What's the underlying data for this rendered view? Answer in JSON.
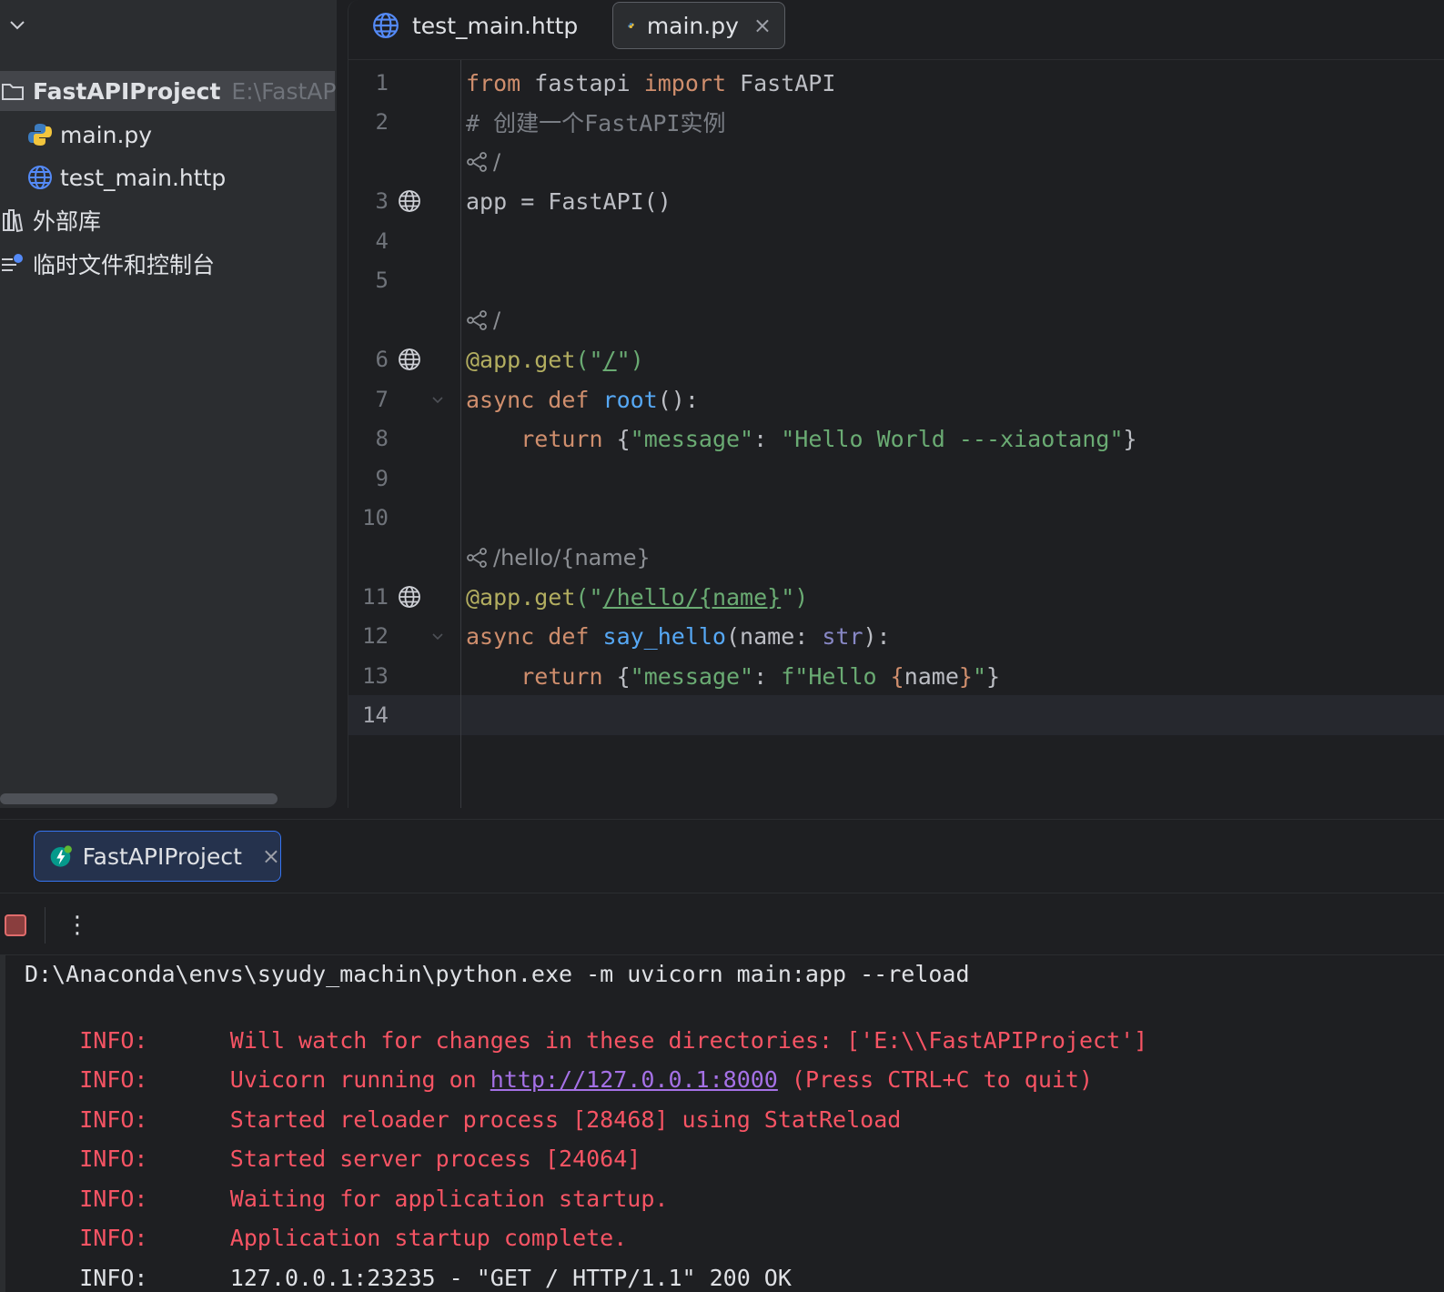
{
  "project": {
    "root_name": "FastAPIProject",
    "root_path": "E:\\FastAPIProj",
    "files": [
      "main.py",
      "test_main.http"
    ],
    "external_libraries": "外部库",
    "scratches": "临时文件和控制台"
  },
  "editor": {
    "tabs": [
      {
        "label": "test_main.http",
        "active": false
      },
      {
        "label": "main.py",
        "active": true
      }
    ],
    "tab_close": "×",
    "line_numbers": [
      "1",
      "2",
      "3",
      "4",
      "5",
      "6",
      "7",
      "8",
      "9",
      "10",
      "11",
      "12",
      "13",
      "14"
    ],
    "inlays": [
      "/",
      "/",
      "/hello/{name}"
    ],
    "code": {
      "l1": [
        "from",
        " fastapi ",
        "import",
        " FastAPI"
      ],
      "l2": "# 创建一个FastAPI实例",
      "l3": "app = FastAPI()",
      "l6": [
        "@app.get",
        "(\"",
        "/",
        "\")"
      ],
      "l7": [
        "async def ",
        "root",
        "():"
      ],
      "l8": [
        "    ",
        "return",
        " {",
        "\"message\"",
        ": ",
        "\"Hello World ---xiaotang\"",
        "}"
      ],
      "l11": [
        "@app.get",
        "(\"",
        "/hello/{name}",
        "\")"
      ],
      "l12": [
        "async def ",
        "say_hello",
        "(name: ",
        "str",
        "):"
      ],
      "l13": [
        "    ",
        "return",
        " {",
        "\"message\"",
        ": ",
        "f\"Hello ",
        "{",
        "name",
        "}",
        "\"",
        "}"
      ]
    }
  },
  "run": {
    "tab_label": "FastAPIProject",
    "tab_close": "×",
    "more": "⋮",
    "console": {
      "command": "D:\\Anaconda\\envs\\syudy_machin\\python.exe -m uvicorn main:app --reload",
      "lines": [
        {
          "level": "INFO:",
          "text": "Will watch for changes in these directories: ['E:\\\\FastAPIProject']"
        },
        {
          "level": "INFO:",
          "pre": "Uvicorn running on ",
          "link": "http://127.0.0.1:8000",
          "post": " (Press CTRL+C to quit)"
        },
        {
          "level": "INFO:",
          "text": "Started reloader process [28468] using StatReload"
        },
        {
          "level": "INFO:",
          "text": "Started server process [24064]"
        },
        {
          "level": "INFO:",
          "text": "Waiting for application startup."
        },
        {
          "level": "INFO:",
          "text": "Application startup complete."
        },
        {
          "level": "INFO:",
          "text": "127.0.0.1:23235 - \"GET / HTTP/1.1\" 200 OK"
        }
      ]
    }
  },
  "colors": {
    "keyword": "#cf8e6d",
    "function": "#56a8f5",
    "string": "#6aab73",
    "comment": "#7a7e85",
    "decorator": "#b3ae60",
    "error_text": "#f75464",
    "link": "#a571e6",
    "accent": "#3574f0"
  }
}
